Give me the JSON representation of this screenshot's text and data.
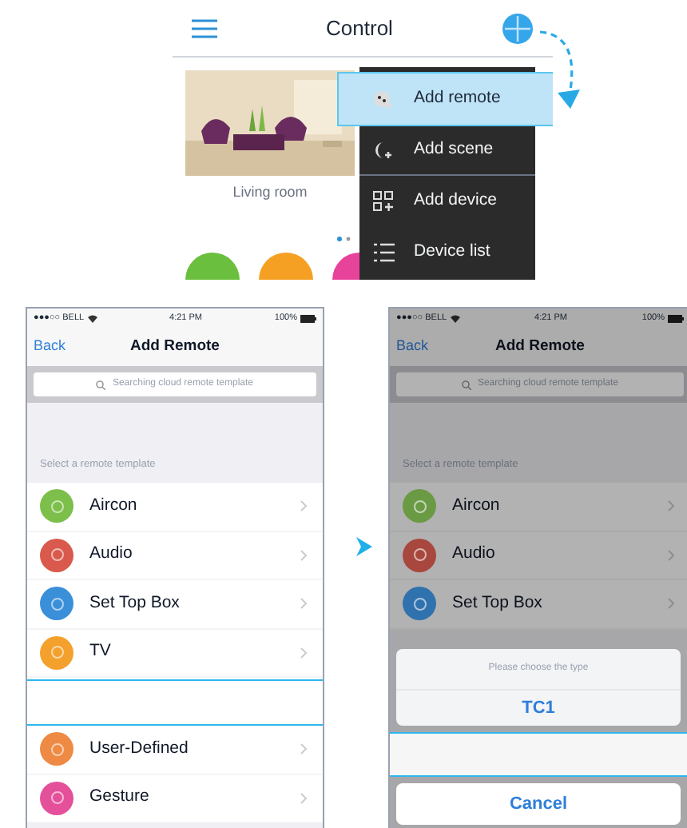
{
  "control_screen": {
    "title": "Control",
    "room_label": "Living room",
    "menu": [
      {
        "label": "Add remote",
        "selected": true
      },
      {
        "label": "Add scene",
        "selected": false
      },
      {
        "label": "Add device",
        "selected": false
      },
      {
        "label": "Device list",
        "selected": false
      }
    ],
    "shortcuts": [
      {
        "color": "#6bbf3f"
      },
      {
        "color": "#f5a023"
      },
      {
        "color": "#e8439a"
      }
    ]
  },
  "phones": [
    {
      "status": {
        "carrier": "●●●○○ BELL",
        "time": "4:21 PM",
        "battery": "100%"
      },
      "back": "Back",
      "title": "Add Remote",
      "search_placeholder": "Searching cloud remote template",
      "section": "Select a remote template",
      "dimmed": false,
      "rows": [
        {
          "kind": "template",
          "label": "Aircon",
          "color": "#7cbf4a"
        },
        {
          "kind": "template",
          "label": "Audio",
          "color": "#d9594c"
        },
        {
          "kind": "template",
          "label": "Set Top Box",
          "color": "#3a8fd9"
        },
        {
          "kind": "template",
          "label": "TV",
          "color": "#f3a12c"
        },
        {
          "kind": "highlight"
        },
        {
          "kind": "template",
          "label": "User-Defined",
          "color": "#ee8a44"
        },
        {
          "kind": "template",
          "label": "Gesture",
          "color": "#e4509a"
        }
      ]
    },
    {
      "status": {
        "carrier": "●●●○○ BELL",
        "time": "4:21 PM",
        "battery": "100%"
      },
      "back": "Back",
      "title": "Add Remote",
      "search_placeholder": "Searching cloud remote template",
      "section": "Select a remote template",
      "dimmed": true,
      "rows": [
        {
          "kind": "template",
          "label": "Aircon",
          "color": "#6a9a44"
        },
        {
          "kind": "template",
          "label": "Audio",
          "color": "#a8473d"
        },
        {
          "kind": "template",
          "label": "Set Top Box",
          "color": "#2f72ae"
        }
      ],
      "sheet": {
        "title": "Please choose the type",
        "options": [
          "TC1"
        ],
        "highlight": true,
        "cancel": "Cancel"
      }
    }
  ]
}
